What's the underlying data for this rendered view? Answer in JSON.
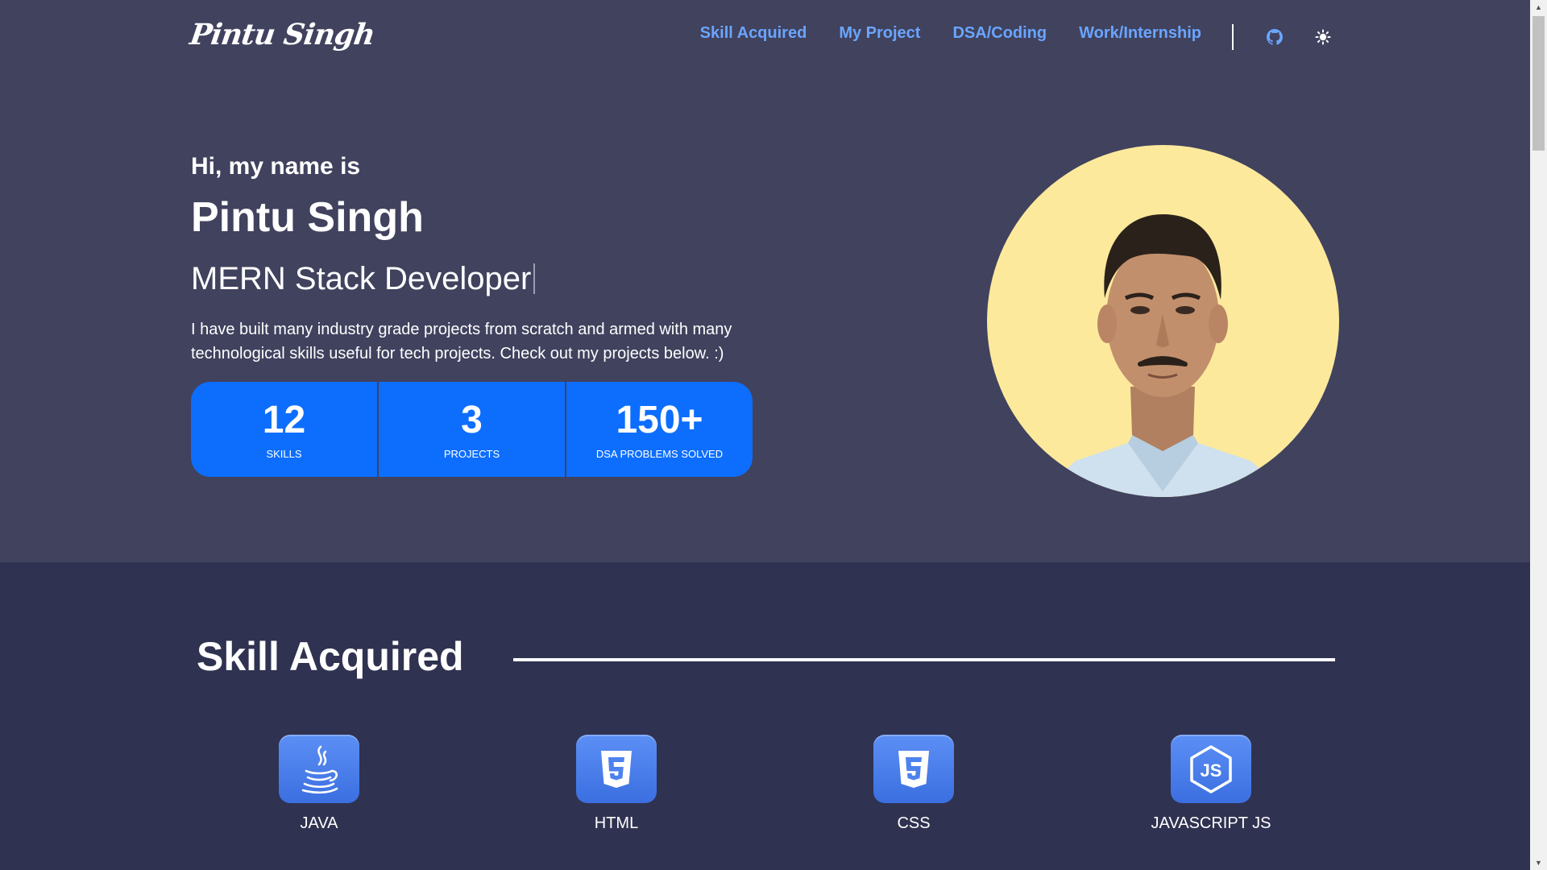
{
  "header": {
    "logo": "Pintu Singh",
    "nav": [
      {
        "label": "Skill Acquired"
      },
      {
        "label": "My Project"
      },
      {
        "label": "DSA/Coding"
      },
      {
        "label": "Work/Internship"
      }
    ],
    "icons": {
      "github": "github-icon",
      "theme": "sun-icon"
    },
    "accent_color": "#6aa5ff"
  },
  "hero": {
    "greeting": "Hi, my name is",
    "name": "Pintu Singh",
    "role": "MERN Stack Developer",
    "description": "I have built many industry grade projects from scratch and armed with many technological skills useful for tech projects. Check out my projects below. :)",
    "stats": [
      {
        "value": "12",
        "label": "SKILLS"
      },
      {
        "value": "3",
        "label": "PROJECTS"
      },
      {
        "value": "150+",
        "label": "DSA PROBLEMS SOLVED"
      }
    ],
    "stat_color": "#0d6efd",
    "avatar_bg": "#fde99c"
  },
  "skills": {
    "title": "Skill Acquired",
    "items": [
      {
        "label": "JAVA",
        "icon": "java-icon"
      },
      {
        "label": "HTML",
        "icon": "html5-icon"
      },
      {
        "label": "CSS",
        "icon": "css3-icon"
      },
      {
        "label": "JAVASCRIPT JS",
        "icon": "javascript-icon"
      }
    ]
  }
}
